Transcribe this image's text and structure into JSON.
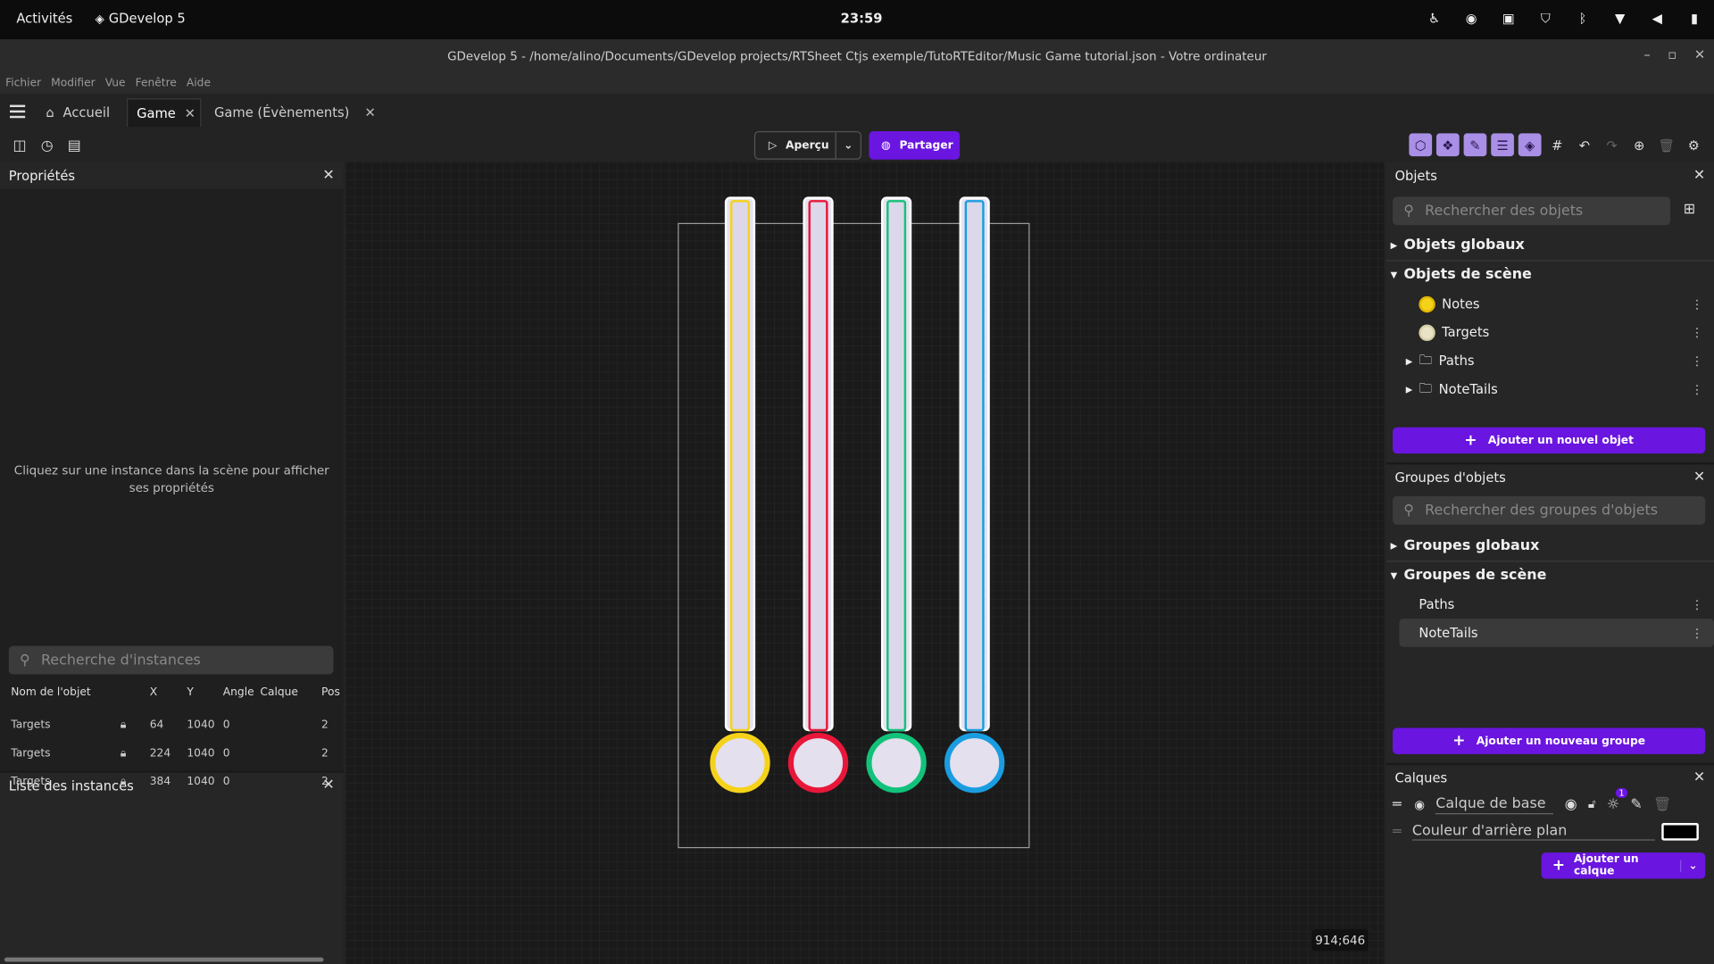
{
  "system": {
    "activities": "Activités",
    "app_name": "GDevelop 5",
    "clock": "23:59",
    "tray_icons": [
      "accessibility-icon",
      "discord-icon",
      "clipboard-icon",
      "shield-icon",
      "bluetooth-icon",
      "wifi-icon",
      "volume-icon",
      "battery-icon"
    ]
  },
  "window": {
    "title": "GDevelop 5 - /home/alino/Documents/GDevelop projects/RTSheet Ctjs exemple/TutoRTEditor/Music Game tutorial.json - Votre ordinateur"
  },
  "menu": {
    "items": [
      "Fichier",
      "Modifier",
      "Vue",
      "Fenêtre",
      "Aide"
    ]
  },
  "tabs": [
    {
      "label": "Accueil"
    },
    {
      "label": "Game"
    },
    {
      "label": "Game (Évènements)"
    }
  ],
  "toolbar": {
    "preview_label": "Aperçu",
    "share_label": "Partager"
  },
  "properties": {
    "title": "Propriétés",
    "empty_message": "Cliquez sur une instance dans la scène pour afficher ses propriétés"
  },
  "instances": {
    "title": "Liste des instances",
    "search_placeholder": "Recherche d'instances",
    "columns": [
      "Nom de l'objet",
      "X",
      "Y",
      "Angle",
      "Calque",
      "Pos"
    ],
    "rows": [
      {
        "name": "Targets",
        "x": "64",
        "y": "1040",
        "angle": "0",
        "layer": "",
        "pos": "2"
      },
      {
        "name": "Targets",
        "x": "224",
        "y": "1040",
        "angle": "0",
        "layer": "",
        "pos": "2"
      },
      {
        "name": "Targets",
        "x": "384",
        "y": "1040",
        "angle": "0",
        "layer": "",
        "pos": "2"
      }
    ]
  },
  "scene": {
    "cursor_coords": "914;646",
    "lanes": [
      {
        "color": "#f5d21a"
      },
      {
        "color": "#e8173a"
      },
      {
        "color": "#12c27a"
      },
      {
        "color": "#1a9de0"
      }
    ]
  },
  "objects": {
    "title": "Objets",
    "search_placeholder": "Rechercher des objets",
    "global_section": "Objets globaux",
    "scene_section": "Objets de scène",
    "items": [
      {
        "label": "Notes",
        "type": "sprite",
        "color": "#f5d21a"
      },
      {
        "label": "Targets",
        "type": "sprite",
        "color": "#e8e2c6"
      },
      {
        "label": "Paths",
        "type": "folder"
      },
      {
        "label": "NoteTails",
        "type": "folder"
      }
    ],
    "add_button": "Ajouter un nouvel objet"
  },
  "groups": {
    "title": "Groupes d'objets",
    "search_placeholder": "Rechercher des groupes d'objets",
    "global_section": "Groupes globaux",
    "scene_section": "Groupes de scène",
    "items": [
      {
        "label": "Paths"
      },
      {
        "label": "NoteTails"
      }
    ],
    "add_button": "Ajouter un nouveau groupe"
  },
  "layers": {
    "title": "Calques",
    "base_layer": "Calque de base",
    "effects_badge": "1",
    "background_color_label": "Couleur d'arrière plan",
    "background_color": "#000000",
    "add_button": "Ajouter un calque"
  },
  "colors": {
    "accent": "#6a15e0",
    "highlight": "#a98fe6"
  }
}
